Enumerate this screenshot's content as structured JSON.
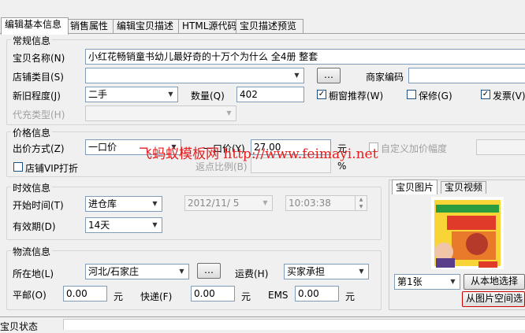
{
  "tabs": [
    {
      "label": "编辑基本信息"
    },
    {
      "label": "销售属性"
    },
    {
      "label": "编辑宝贝描述"
    },
    {
      "label": "HTML源代码"
    },
    {
      "label": "宝贝描述预览"
    }
  ],
  "general": {
    "group_title": "常规信息",
    "name_label": "宝贝名称(N)",
    "name_value": "小红花畅销童书幼儿最好奇的十万个为什么 全4册 整套",
    "category_label": "店铺类目(S)",
    "category_value": "",
    "browse_label": "…",
    "merchant_code_label": "商家编码",
    "merchant_code_value": "",
    "condition_label": "新旧程度(J)",
    "condition_value": "二手",
    "quantity_label": "数量(Q)",
    "quantity_value": "402",
    "recommend_label": "橱窗推荐(W)",
    "warranty_label": "保修(G)",
    "invoice_label": "发票(V)",
    "agent_type_label": "代充类型(H)",
    "agent_type_value": ""
  },
  "price": {
    "group_title": "价格信息",
    "method_label": "出价方式(Z)",
    "method_value": "一口价",
    "fixed_price_label": "一口价(Y)",
    "fixed_price_value": "27.00",
    "unit": "元",
    "custom_increment_label": "自定义加价幅度",
    "vip_label": "店铺VIP打折",
    "rebate_label": "返点比例(B)",
    "rebate_value": "",
    "percent": "%"
  },
  "timing": {
    "group_title": "时效信息",
    "start_label": "开始时间(T)",
    "start_value": "进仓库",
    "date_value": "2012/11/ 5",
    "time_value": "10:03:38",
    "valid_label": "有效期(D)",
    "valid_value": "14天"
  },
  "logistics": {
    "group_title": "物流信息",
    "location_label": "所在地(L)",
    "location_value": "河北/石家庄",
    "browse_label": "…",
    "freight_label": "运费(H)",
    "freight_value": "买家承担",
    "mail_label": "平邮(O)",
    "mail_value": "0.00",
    "express_label": "快递(F)",
    "express_value": "0.00",
    "ems_label": "EMS",
    "ems_value": "0.00",
    "unit": "元"
  },
  "media": {
    "tab_picture": "宝贝图片",
    "tab_video": "宝贝视频",
    "picture_index": "第1张",
    "local_select_label": "从本地选择",
    "space_label": "从图片空间选"
  },
  "status": {
    "label": "宝贝状态"
  },
  "watermark": {
    "text": "飞蚂蚁模板网 http://www.feimayi.net"
  },
  "colors": {
    "watermark": "#e81c1c",
    "accent": "#1c5180"
  }
}
